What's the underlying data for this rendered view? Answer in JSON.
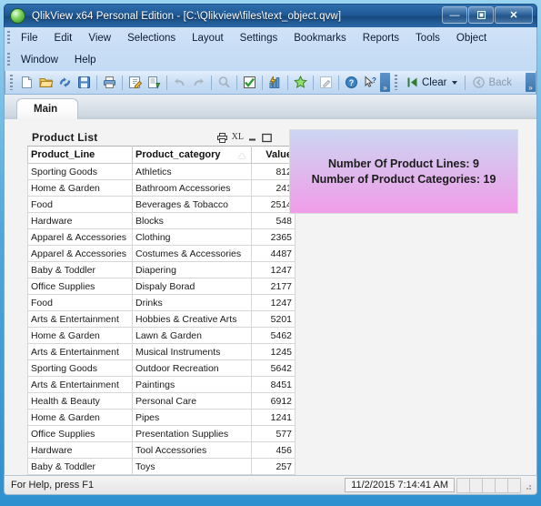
{
  "window": {
    "title": "QlikView x64 Personal Edition - [C:\\Qlikview\\files\\text_object.qvw]",
    "app_icon": "qlikview-logo-icon",
    "controls": {
      "minimize": "—",
      "maximize": "❒",
      "close": "✕"
    }
  },
  "menu": {
    "row1": [
      "File",
      "Edit",
      "View",
      "Selections",
      "Layout",
      "Settings",
      "Bookmarks",
      "Reports",
      "Tools",
      "Object"
    ],
    "row2": [
      "Window",
      "Help"
    ]
  },
  "mdi_controls": {
    "minimize": "–",
    "restore": "❐",
    "close": "✕"
  },
  "toolbar": {
    "buttons": [
      {
        "name": "new-document-icon",
        "glyph": "🗋"
      },
      {
        "name": "open-document-icon",
        "glyph": "📂"
      },
      {
        "name": "reload-icon",
        "glyph": "↯"
      },
      {
        "name": "save-icon",
        "glyph": "💾"
      },
      {
        "name": "print-icon",
        "glyph": "🖨"
      },
      {
        "name": "edit-script-icon",
        "glyph": "📝"
      },
      {
        "name": "table-viewer-icon",
        "glyph": "🗂"
      },
      {
        "name": "undo-icon",
        "glyph": "↶"
      },
      {
        "name": "redo-icon",
        "glyph": "↷"
      },
      {
        "name": "search-icon",
        "glyph": "🔍"
      },
      {
        "name": "current-selections-icon",
        "glyph": "☑"
      },
      {
        "name": "quick-chart-icon",
        "glyph": "📊"
      },
      {
        "name": "add-bookmark-icon",
        "glyph": "★"
      },
      {
        "name": "design-grid-icon",
        "glyph": "✎"
      },
      {
        "name": "help-icon",
        "glyph": "?"
      },
      {
        "name": "context-help-icon",
        "glyph": "↖"
      }
    ],
    "overflow_glyph": "»",
    "clear_label": "Clear",
    "clear_icon": "clear-selections-icon",
    "back_label": "Back",
    "back_icon": "back-arrow-icon"
  },
  "tabs": [
    {
      "label": "Main"
    }
  ],
  "table_object": {
    "title": "Product List",
    "caption_icons": [
      {
        "name": "print-object-icon",
        "glyph": "⎙"
      },
      {
        "name": "export-to-excel-icon",
        "glyph": "XL"
      },
      {
        "name": "minimize-object-icon",
        "glyph": "—"
      },
      {
        "name": "maximize-object-icon",
        "glyph": "▭"
      }
    ],
    "columns": [
      "Product_Line",
      "Product_category",
      "Value"
    ],
    "sort_column": "Product_category",
    "rows": [
      [
        "Sporting Goods",
        "Athletics",
        "812"
      ],
      [
        "Home & Garden",
        "Bathroom Accessories",
        "241"
      ],
      [
        "Food",
        "Beverages & Tobacco",
        "2514"
      ],
      [
        "Hardware",
        "Blocks",
        "548"
      ],
      [
        "Apparel & Accessories",
        "Clothing",
        "2365"
      ],
      [
        "Apparel & Accessories",
        "Costumes & Accessories",
        "4487"
      ],
      [
        "Baby & Toddler",
        "Diapering",
        "1247"
      ],
      [
        "Office Supplies",
        "Dispaly Borad",
        "2177"
      ],
      [
        "Food",
        "Drinks",
        "1247"
      ],
      [
        "Arts & Entertainment",
        "Hobbies & Creative Arts",
        "5201"
      ],
      [
        "Home & Garden",
        "Lawn & Garden",
        "5462"
      ],
      [
        "Arts & Entertainment",
        "Musical Instruments",
        "1245"
      ],
      [
        "Sporting Goods",
        "Outdoor Recreation",
        "5642"
      ],
      [
        "Arts & Entertainment",
        "Paintings",
        "8451"
      ],
      [
        "Health & Beauty",
        "Personal Care",
        "6912"
      ],
      [
        "Home & Garden",
        "Pipes",
        "1241"
      ],
      [
        "Office Supplies",
        "Presentation Supplies",
        "577"
      ],
      [
        "Hardware",
        "Tool Accessories",
        "456"
      ],
      [
        "Baby & Toddler",
        "Toys",
        "257"
      ]
    ]
  },
  "text_object": {
    "line1": "Number Of Product Lines: 9",
    "line2": "Number of Product Categories: 19",
    "gradient_top": "#ccd6f2",
    "gradient_bottom": "#f09ce8"
  },
  "statusbar": {
    "help_text": "For Help, press F1",
    "datetime": "11/2/2015 7:14:41 AM"
  }
}
